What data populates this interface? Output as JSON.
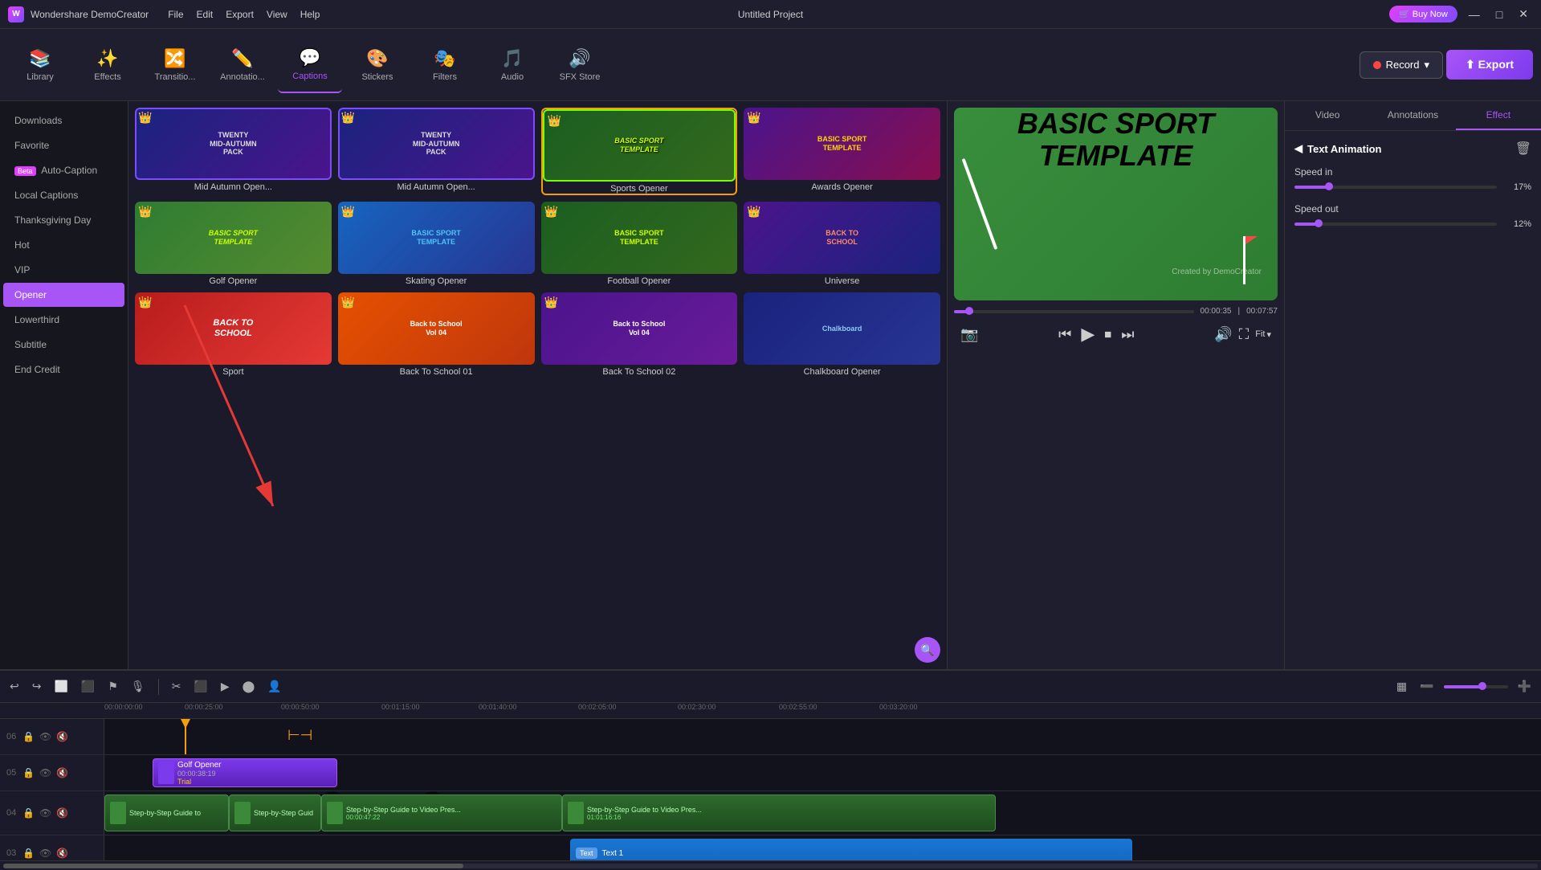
{
  "app": {
    "name": "Wondershare DemoCreator",
    "title": "Untitled Project",
    "logo": "W"
  },
  "menu": {
    "items": [
      "File",
      "Edit",
      "Export",
      "View",
      "Help"
    ]
  },
  "toolbar": {
    "items": [
      {
        "id": "library",
        "label": "Library",
        "icon": "📚"
      },
      {
        "id": "effects",
        "label": "Effects",
        "icon": "✨"
      },
      {
        "id": "transitions",
        "label": "Transitio...",
        "icon": "🔀"
      },
      {
        "id": "annotations",
        "label": "Annotatio...",
        "icon": "✏️"
      },
      {
        "id": "captions",
        "label": "Captions",
        "icon": "💬"
      },
      {
        "id": "stickers",
        "label": "Stickers",
        "icon": "🎨"
      },
      {
        "id": "filters",
        "label": "Filters",
        "icon": "🎭"
      },
      {
        "id": "audio",
        "label": "Audio",
        "icon": "🎵"
      },
      {
        "id": "sfx",
        "label": "SFX Store",
        "icon": "🔊"
      }
    ],
    "active": "captions",
    "record_label": "Record",
    "export_label": "⬆ Export",
    "buy_now": "🛒 Buy Now"
  },
  "sidebar": {
    "items": [
      {
        "id": "downloads",
        "label": "Downloads",
        "active": false,
        "beta": false
      },
      {
        "id": "favorite",
        "label": "Favorite",
        "active": false,
        "beta": false
      },
      {
        "id": "auto-caption",
        "label": "Auto-Caption",
        "active": false,
        "beta": true
      },
      {
        "id": "local-captions",
        "label": "Local Captions",
        "active": false,
        "beta": false
      },
      {
        "id": "thanksgiving",
        "label": "Thanksgiving Day",
        "active": false,
        "beta": false
      },
      {
        "id": "hot",
        "label": "Hot",
        "active": false,
        "beta": false
      },
      {
        "id": "vip",
        "label": "VIP",
        "active": false,
        "beta": false
      },
      {
        "id": "opener",
        "label": "Opener",
        "active": true,
        "beta": false
      },
      {
        "id": "lowerthird",
        "label": "Lowerthird",
        "active": false,
        "beta": false
      },
      {
        "id": "subtitle",
        "label": "Subtitle",
        "active": false,
        "beta": false
      },
      {
        "id": "end-credit",
        "label": "End Credit",
        "active": false,
        "beta": false
      }
    ]
  },
  "content": {
    "templates": [
      {
        "id": "mid-autumn-1",
        "label": "Mid Autumn Open...",
        "thumb_type": "mid-autumn",
        "crown": true,
        "text": "TWENTY MID-AUTUMN PACK"
      },
      {
        "id": "mid-autumn-2",
        "label": "Mid Autumn Open...",
        "thumb_type": "mid-autumn",
        "crown": true,
        "text": "TWENTY MID-AUTUMN PACK"
      },
      {
        "id": "sports",
        "label": "Sports Opener",
        "thumb_type": "sports",
        "crown": true,
        "text": "BASIC SPORT TEMPLATE",
        "selected": true
      },
      {
        "id": "awards",
        "label": "Awards Opener",
        "thumb_type": "awards",
        "crown": true,
        "text": "BASIC SPORT TEMPLATE"
      },
      {
        "id": "golf",
        "label": "Golf Opener",
        "thumb_type": "golf",
        "crown": true,
        "text": "BASIC SPORT TEMPLATE"
      },
      {
        "id": "skating",
        "label": "Skating Opener",
        "thumb_type": "skating",
        "crown": true,
        "text": "BASIC SPORT TEMPLATE"
      },
      {
        "id": "football",
        "label": "Football Opener",
        "thumb_type": "football",
        "crown": true,
        "text": "BASIC SPORT TEMPLATE"
      },
      {
        "id": "universe",
        "label": "Universe",
        "thumb_type": "universe",
        "crown": true,
        "text": "BACK TO SCHOOL"
      },
      {
        "id": "sport",
        "label": "Sport",
        "thumb_type": "sport-red",
        "crown": true,
        "text": "BACK TO SCHOOL"
      },
      {
        "id": "back1",
        "label": "Back To School  01",
        "thumb_type": "back1",
        "crown": true,
        "text": "Back to School Vol 04"
      },
      {
        "id": "back2",
        "label": "Back To School 02",
        "thumb_type": "back2",
        "crown": true,
        "text": "Back to School Vol 04"
      },
      {
        "id": "chalkboard",
        "label": "Chalkboard Opener",
        "thumb_type": "chalkboard",
        "crown": false,
        "text": "Chalkboard"
      }
    ]
  },
  "preview": {
    "main_text_line1": "BASIC SPORT",
    "main_text_line2": "TEMPLATE",
    "watermark": "Created by DemoCreator",
    "time_current": "00:00:35",
    "time_total": "00:07:57",
    "progress_pct": 8,
    "fit_label": "Fit"
  },
  "properties": {
    "tabs": [
      {
        "id": "video",
        "label": "Video"
      },
      {
        "id": "annotations",
        "label": "Annotations"
      },
      {
        "id": "effect",
        "label": "Effect",
        "active": true
      }
    ],
    "text_animation": {
      "title": "Text Animation",
      "speed_in_label": "Speed in",
      "speed_in_value": "17%",
      "speed_in_pct": 17,
      "speed_out_label": "Speed out",
      "speed_out_value": "12%",
      "speed_out_pct": 12
    }
  },
  "timeline": {
    "toolbar_buttons": [
      "↩",
      "↪",
      "⬜",
      "⬛",
      "⚑",
      "🎙",
      "|",
      "✂",
      "⬛",
      "▶",
      "⬤",
      "👤"
    ],
    "ruler_marks": [
      "00:00:00:00",
      "00:00:25:00",
      "00:00:50:00",
      "00:01:15:00",
      "00:01:40:00",
      "00:02:05:00",
      "00:02:30:00",
      "00:02:55:00",
      "00:03:20:00"
    ],
    "tracks": [
      {
        "num": "06",
        "type": "empty"
      },
      {
        "num": "05",
        "type": "opener",
        "clip_label": "Golf Opener",
        "clip_time": "00:00:38:19",
        "clip_sub": "Trial"
      },
      {
        "num": "04",
        "type": "video",
        "clips": [
          {
            "label": "Step-by-Step Guide to",
            "time": ""
          },
          {
            "label": "Step-by-Step Guid",
            "time": ""
          },
          {
            "label": "Step-by-Step Guide to Video Pres...",
            "time": "00:00:47:22"
          },
          {
            "label": "Step-by-Step Guide to Video Pres...",
            "time": "01:01:16:16"
          }
        ]
      },
      {
        "num": "03",
        "type": "text",
        "clip_label": "Text 1",
        "text_badge": "Text"
      }
    ],
    "playhead_pos": "00:00:25:00"
  },
  "icons": {
    "chevron_down": "▼",
    "search": "🔍",
    "delete": "🗑",
    "camera": "📷",
    "volume": "🔊",
    "fullscreen": "⛶",
    "prev": "⏮",
    "play": "▶",
    "stop": "⏹",
    "next_frame": "⏭",
    "lock": "🔒",
    "eye": "👁",
    "audio_off": "🔇",
    "undo": "↩",
    "redo": "↪",
    "zoom_in": "➕",
    "zoom_out": "➖"
  }
}
